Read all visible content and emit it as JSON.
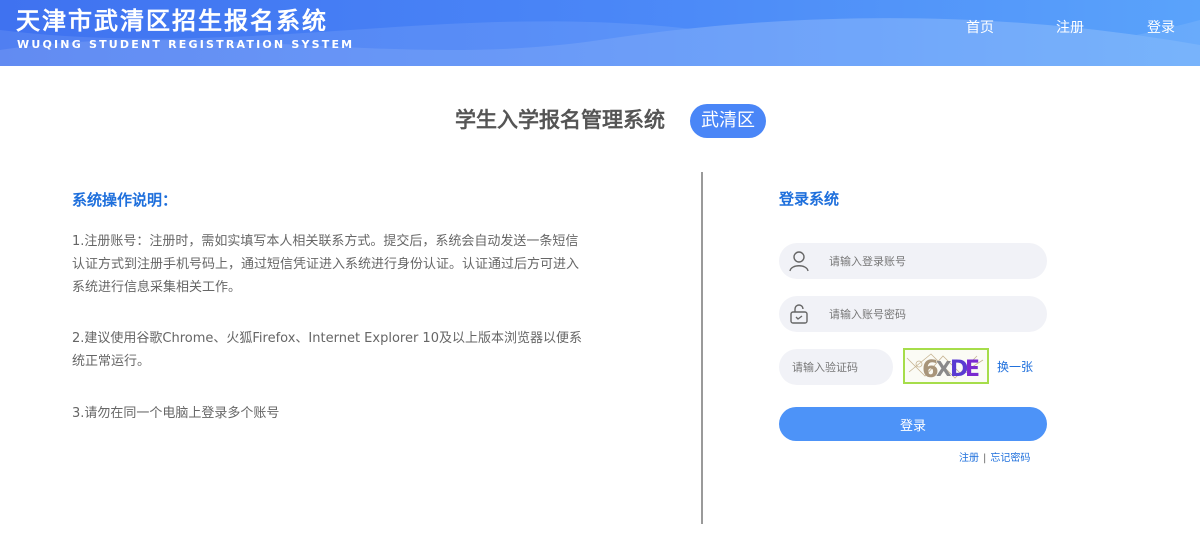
{
  "header": {
    "title": "天津市武清区招生报名系统",
    "subtitle": "WUQING STUDENT REGISTRATION SYSTEM",
    "nav": {
      "home": "首页",
      "register": "注册",
      "login": "登录"
    }
  },
  "main": {
    "system_title": "学生入学报名管理系统",
    "district_badge": "武清区"
  },
  "instructions": {
    "heading": "系统操作说明：",
    "items": [
      "1.注册账号：注册时，需如实填写本人相关联系方式。提交后，系统会自动发送一条短信认证方式到注册手机号码上，通过短信凭证进入系统进行身份认证。认证通过后方可进入系统进行信息采集相关工作。",
      "2.建议使用谷歌Chrome、火狐Firefox、Internet Explorer 10及以上版本浏览器以便系统正常运行。",
      "3.请勿在同一个电脑上登录多个账号"
    ]
  },
  "login": {
    "heading": "登录系统",
    "username_placeholder": "请输入登录账号",
    "password_placeholder": "请输入账号密码",
    "captcha_placeholder": "请输入验证码",
    "captcha_text": "6XDE",
    "refresh_label": "换一张",
    "submit_label": "登录",
    "register_link": "注册",
    "separator": "|",
    "forgot_link": "忘记密码"
  },
  "colors": {
    "header_start": "#3f72f0",
    "header_end": "#5aa3fb",
    "accent_blue": "#1e6fdc",
    "button_blue": "#4d93f8",
    "captcha_border": "#a6dd4a"
  },
  "icons": {
    "username": "user-icon",
    "password": "lock-icon"
  }
}
